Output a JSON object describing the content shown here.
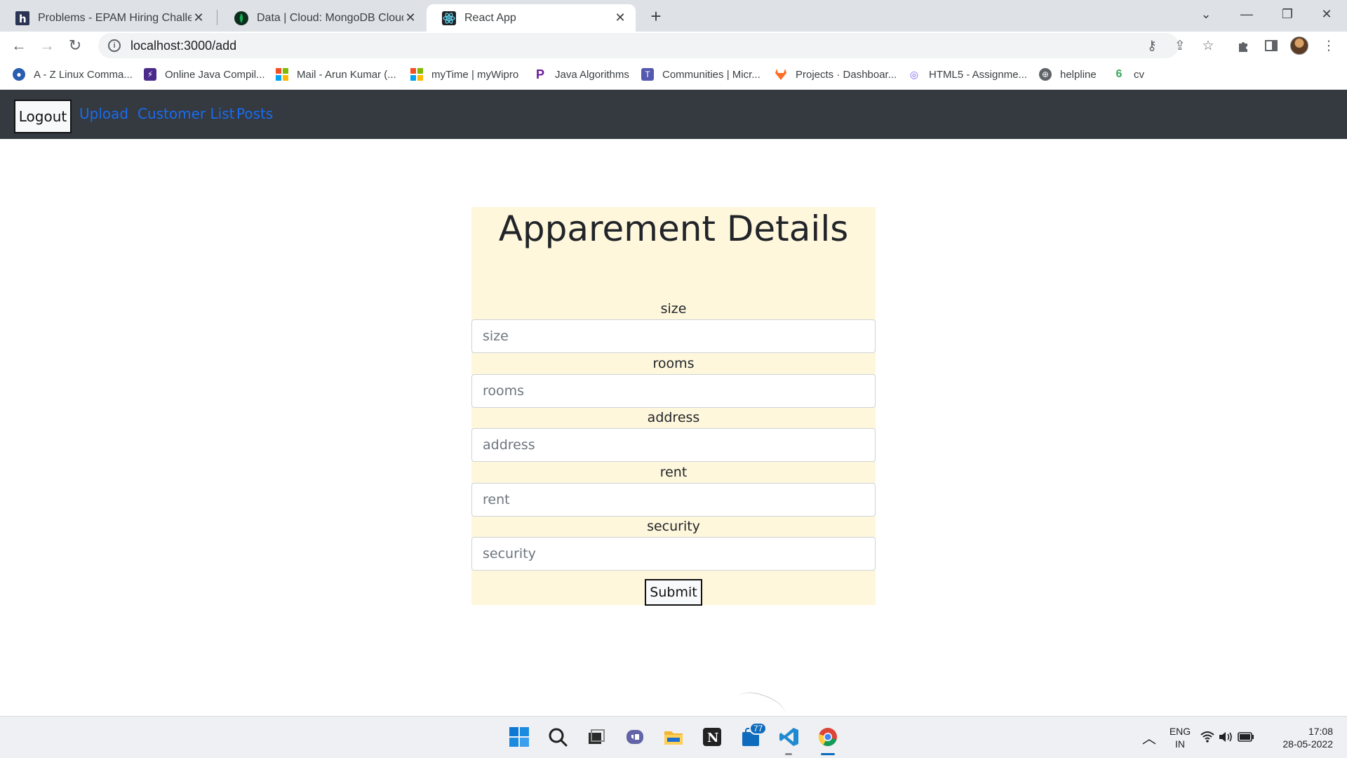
{
  "browser": {
    "tabs": [
      {
        "title": "Problems - EPAM Hiring Challenge",
        "icon": "hackerearth-icon"
      },
      {
        "title": "Data | Cloud: MongoDB Cloud",
        "icon": "mongodb-leaf-icon"
      },
      {
        "title": "React App",
        "icon": "react-icon",
        "active": true
      }
    ],
    "url": "localhost:3000/add",
    "bookmarks": [
      "A - Z Linux Comma...",
      "Online Java Compil...",
      "Mail - Arun Kumar (...",
      "myTime | myWipro",
      "Java Algorithms",
      "Communities | Micr...",
      "Projects · Dashboar...",
      "HTML5 - Assignme...",
      "helpline",
      "cv"
    ]
  },
  "app": {
    "nav": {
      "logout_label": "Logout",
      "links": [
        "Upload",
        "Customer List",
        "Posts"
      ]
    },
    "form": {
      "title": "Apparement Details",
      "fields": [
        {
          "label": "size",
          "placeholder": "size"
        },
        {
          "label": "rooms",
          "placeholder": "rooms"
        },
        {
          "label": "address",
          "placeholder": "address"
        },
        {
          "label": "rent",
          "placeholder": "rent"
        },
        {
          "label": "security",
          "placeholder": "security"
        }
      ],
      "submit_label": "Submit"
    },
    "colors": {
      "navbar_bg": "#343a40",
      "nav_link": "#1a6bf0",
      "card_bg": "#fff7dc"
    }
  },
  "taskbar": {
    "badge_count": "77",
    "language": "ENG",
    "region": "IN",
    "time": "17:08",
    "date": "28-05-2022"
  }
}
